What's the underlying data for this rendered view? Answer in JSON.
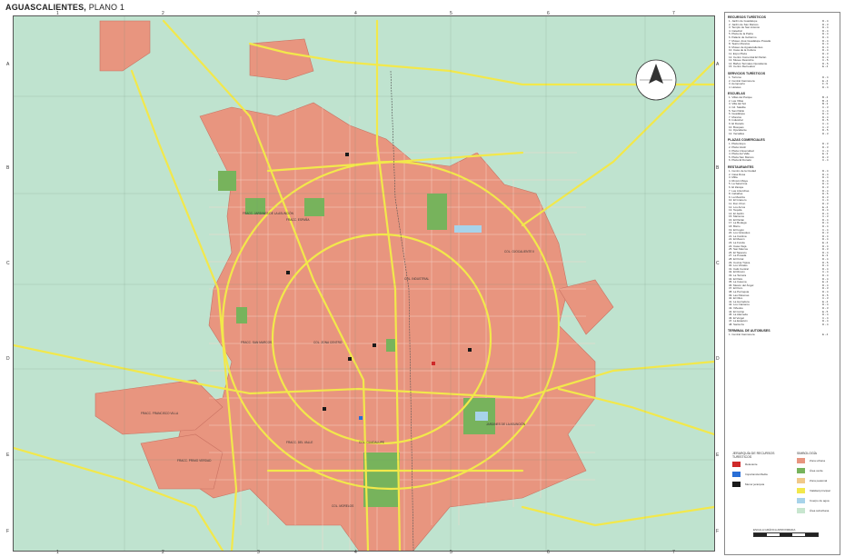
{
  "title": {
    "main": "AGUASCALIENTES,",
    "sub": "PLANO 1"
  },
  "grid": {
    "columns_top": [
      "1",
      "2",
      "3",
      "4",
      "5",
      "6",
      "7"
    ],
    "columns_bottom": [
      "1",
      "2",
      "3",
      "4",
      "5",
      "6",
      "7"
    ],
    "rows": [
      "A",
      "B",
      "C",
      "D",
      "E",
      "F"
    ]
  },
  "colors": {
    "urban": "#e8957f",
    "green": "#77b35c",
    "background": "#bfe3cf",
    "road": "#f2e84b",
    "pedestrian": "#f0c98a",
    "water": "#a7d3ea",
    "suburban": "#c8e6cf",
    "high": "#cf2a2a",
    "medium": "#2a6fd6",
    "minor": "#1a1a1a"
  },
  "compass_icon": "north-arrow-icon",
  "map_labels": [
    "FRACC. FRANCISCO VILLA",
    "FRACC. JARDINES DE LA ASUNCIÓN",
    "COL. GUADALUPE",
    "FRACC. ESPAÑA",
    "COL. OJOCALIENTE II",
    "FRACC. SAN MARCOS",
    "COL. INDUSTRIAL",
    "FRACC. DEL VALLE",
    "COL. ZONA CENTRO",
    "JARDINES DE LA ASUNCIÓN",
    "FRACC. PRIMO VERDAD",
    "COL. MORELOS"
  ],
  "sidebar": {
    "sections": [
      {
        "header": "RECURSOS TURÍSTICOS",
        "items": [
          {
            "n": "1. Jardín de Guadalupe",
            "q": "D - 4"
          },
          {
            "n": "2. Jardín de San Marcos",
            "q": "D - 3"
          },
          {
            "n": "3. Templo de San Antonio",
            "q": "D - 4"
          },
          {
            "n": "4. Catedral",
            "q": "D - 4"
          },
          {
            "n": "5. Plaza de la Patria",
            "q": "D - 4"
          },
          {
            "n": "6. Palacio de Gobierno",
            "q": "D - 4"
          },
          {
            "n": "7. Museo José Guadalupe Posada",
            "q": "D - 4"
          },
          {
            "n": "8. Teatro Morelos",
            "q": "D - 4"
          },
          {
            "n": "9. Museo de Aguascalientes",
            "q": "D - 4"
          },
          {
            "n": "10. Casa de la Cultura",
            "q": "D - 4"
          },
          {
            "n": "11. Expo Plaza",
            "q": "D - 3"
          },
          {
            "n": "12. Centro Comercial El Parián",
            "q": "D - 4"
          },
          {
            "n": "13. Museo Descubre",
            "q": "C - 5"
          },
          {
            "n": "14. Baños Termales Ojocaliente",
            "q": "D - 5"
          },
          {
            "n": "15. Centro Recreativo",
            "q": "E - 4"
          }
        ]
      },
      {
        "header": "SERVICIOS TURÍSTICOS",
        "items": [
          {
            "n": "1. Turismo",
            "q": "D - 4"
          },
          {
            "n": "2. Central Camionera",
            "q": "E - 4"
          },
          {
            "n": "3. Aeropuerto",
            "q": "F - 5"
          },
          {
            "n": "4. Hoteles",
            "q": "D - 4"
          }
        ]
      },
      {
        "header": "ESCUELAS",
        "items": [
          {
            "n": "1. Villas del Parque",
            "q": "B - 4"
          },
          {
            "n": "2. Las Villas",
            "q": "B - 4"
          },
          {
            "n": "3. Villa del Sol",
            "q": "B - 3"
          },
          {
            "n": "4. Cd. Satélite",
            "q": "C - 3"
          },
          {
            "n": "5. San Pablo",
            "q": "C - 4"
          },
          {
            "n": "6. Guadalupe",
            "q": "D - 4"
          },
          {
            "n": "7. Morelos",
            "q": "D - 4"
          },
          {
            "n": "8. Industrial",
            "q": "D - 5"
          },
          {
            "n": "9. El Dorado",
            "q": "C - 4"
          },
          {
            "n": "10. Bosques",
            "q": "C - 3"
          },
          {
            "n": "11. Ojocaliente",
            "q": "D - 5"
          },
          {
            "n": "12. Versalles",
            "q": "D - 3"
          }
        ]
      },
      {
        "header": "PLAZAS COMERCIALES",
        "items": [
          {
            "n": "1. Plaza Expo",
            "q": "D - 3"
          },
          {
            "n": "2. Plaza Vestir",
            "q": "D - 3"
          },
          {
            "n": "3. Plaza Universidad",
            "q": "C - 4"
          },
          {
            "n": "4. Plaza del Valle",
            "q": "E - 3"
          },
          {
            "n": "5. Plaza San Marcos",
            "q": "D - 3"
          },
          {
            "n": "6. Plaza El Dorado",
            "q": "C - 4"
          }
        ]
      },
      {
        "header": "RESTAURANTES",
        "items": [
          {
            "n": "1. Centro de la Ciudad",
            "q": "D - 4"
          },
          {
            "n": "2. Casa Rosa",
            "q": "D - 4"
          },
          {
            "n": "3. Mitla",
            "q": "D - 4"
          },
          {
            "n": "4. Rincón Maya",
            "q": "D - 4"
          },
          {
            "n": "5. La Saturnina",
            "q": "D - 4"
          },
          {
            "n": "6. El Zarape",
            "q": "D - 3"
          },
          {
            "n": "7. Las Antorchas",
            "q": "D - 4"
          },
          {
            "n": "8. Cabañas",
            "q": "D - 5"
          },
          {
            "n": "9. La Mestiza",
            "q": "D - 3"
          },
          {
            "n": "10. El Granero",
            "q": "C - 4"
          },
          {
            "n": "11. Don Chon",
            "q": "D - 3"
          },
          {
            "n": "12. Los Arcos",
            "q": "E - 4"
          },
          {
            "n": "13. Tequila",
            "q": "D - 4"
          },
          {
            "n": "14. El Jardín",
            "q": "D - 4"
          },
          {
            "n": "15. Mariscos",
            "q": "C - 3"
          },
          {
            "n": "16. El Parián",
            "q": "D - 4"
          },
          {
            "n": "17. La Bodega",
            "q": "D - 4"
          },
          {
            "n": "18. Bistro",
            "q": "D - 4"
          },
          {
            "n": "19. El Fogón",
            "q": "C - 4"
          },
          {
            "n": "20. Los Girasoles",
            "q": "D - 3"
          },
          {
            "n": "21. La Cantina",
            "q": "D - 4"
          },
          {
            "n": "22. El Mesón",
            "q": "D - 4"
          },
          {
            "n": "23. La Fonda",
            "q": "E - 4"
          },
          {
            "n": "24. Casa Vieja",
            "q": "D - 4"
          },
          {
            "n": "25. San Marcos",
            "q": "D - 3"
          },
          {
            "n": "26. El Tapanco",
            "q": "D - 4"
          },
          {
            "n": "27. La Posada",
            "q": "E - 3"
          },
          {
            "n": "28. El Portal",
            "q": "D - 4"
          },
          {
            "n": "29. Cocina Típica",
            "q": "D - 5"
          },
          {
            "n": "30. Los Vitrales",
            "q": "D - 4"
          },
          {
            "n": "31. Café Central",
            "q": "D - 4"
          },
          {
            "n": "32. El Rincón",
            "q": "C - 4"
          },
          {
            "n": "33. La Terraza",
            "q": "D - 4"
          },
          {
            "n": "34. El Patio",
            "q": "D - 4"
          },
          {
            "n": "35. La Casona",
            "q": "E - 4"
          },
          {
            "n": "36. Mesón del Ángel",
            "q": "D - 4"
          },
          {
            "n": "37. El Pozo",
            "q": "D - 3"
          },
          {
            "n": "38. La Parroquia",
            "q": "D - 4"
          },
          {
            "n": "39. Las Palomas",
            "q": "D - 5"
          },
          {
            "n": "40. El Olivo",
            "q": "C - 3"
          },
          {
            "n": "41. La Herradura",
            "q": "E - 4"
          },
          {
            "n": "42. Los Cántaros",
            "q": "D - 4"
          },
          {
            "n": "43. Viñedos",
            "q": "D - 3"
          },
          {
            "n": "44. El Cortijo",
            "q": "E - 5"
          },
          {
            "n": "45. La Alameda",
            "q": "D - 4"
          },
          {
            "n": "46. El Vergel",
            "q": "C - 4"
          },
          {
            "n": "47. La Estación",
            "q": "D - 4"
          },
          {
            "n": "48. Santa Fe",
            "q": "D - 4"
          }
        ]
      },
      {
        "header": "TERMINAL DE AUTOBUSES",
        "items": [
          {
            "n": "1. Central Camionera",
            "q": "E - 4"
          }
        ]
      }
    ]
  },
  "legend_hierarchy": {
    "title": "JERARQUÍA DE RECURSOS TURÍSTICOS",
    "items": [
      {
        "label": "Relevante",
        "color": "#cf2a2a"
      },
      {
        "label": "Importancia Media",
        "color": "#2a6fd6"
      },
      {
        "label": "Menor jerarquía",
        "color": "#1a1a1a"
      }
    ]
  },
  "legend_symbols": {
    "title": "SIMBOLOGÍA",
    "items": [
      {
        "label": "Zona urbana",
        "color": "#e8957f"
      },
      {
        "label": "Área verde",
        "color": "#77b35c"
      },
      {
        "label": "Zona peatonal",
        "color": "#f0c98a"
      },
      {
        "label": "Vialidad principal",
        "color": "#f2e84b"
      },
      {
        "label": "Cuerpo de agua",
        "color": "#a7d3ea"
      },
      {
        "label": "Área suburbana",
        "color": "#c8e6cf"
      }
    ]
  },
  "scale": {
    "label": "ESCALA GRÁFICA APROXIMADA"
  }
}
